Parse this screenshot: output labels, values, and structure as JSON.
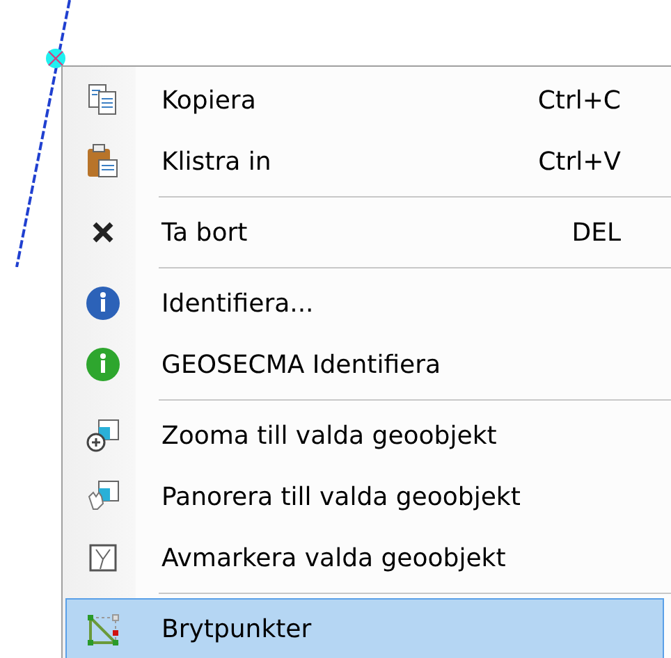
{
  "context_menu": {
    "entries": [
      {
        "kind": "item",
        "label": "Kopiera",
        "shortcut": "Ctrl+C",
        "selected": false
      },
      {
        "kind": "item",
        "label": "Klistra in",
        "shortcut": "Ctrl+V",
        "selected": false
      },
      {
        "kind": "separator"
      },
      {
        "kind": "item",
        "label": "Ta bort",
        "shortcut": "DEL",
        "selected": false
      },
      {
        "kind": "separator"
      },
      {
        "kind": "item",
        "label": "Identifiera...",
        "selected": false
      },
      {
        "kind": "item",
        "label": "GEOSECMA Identifiera",
        "selected": false
      },
      {
        "kind": "separator"
      },
      {
        "kind": "item",
        "label": "Zooma till valda geoobjekt",
        "selected": false
      },
      {
        "kind": "item",
        "label": "Panorera till valda geoobjekt",
        "selected": false
      },
      {
        "kind": "item",
        "label": "Avmarkera valda geoobjekt",
        "selected": false
      },
      {
        "kind": "separator"
      },
      {
        "kind": "item",
        "label": "Brytpunkter",
        "selected": true
      }
    ]
  }
}
